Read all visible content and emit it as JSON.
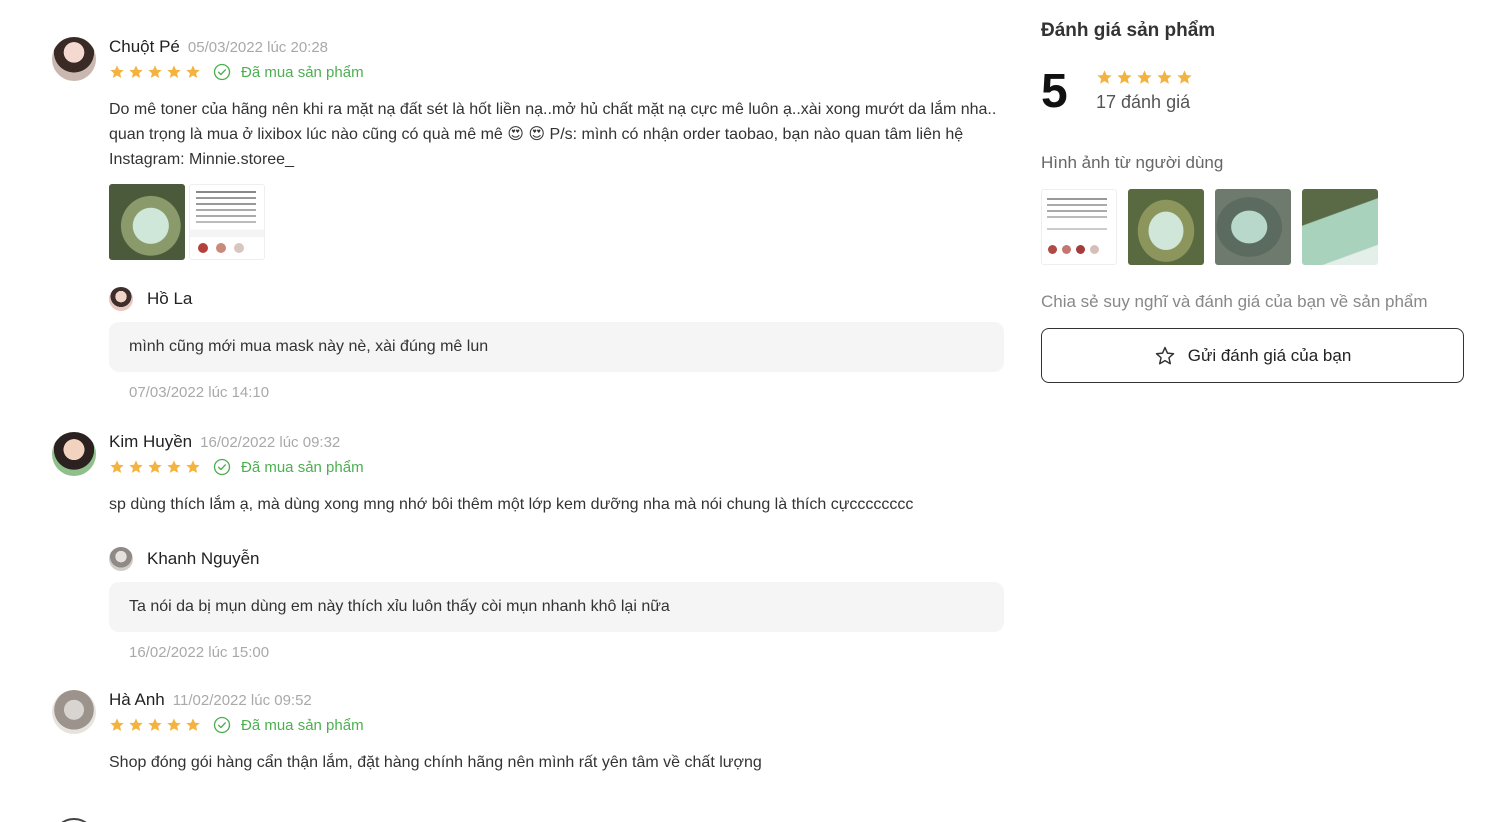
{
  "reviews": [
    {
      "name": "Chuột Pé",
      "time": "05/03/2022 lúc 20:28",
      "rating": 5,
      "verified_label": "Đã mua sản phẩm",
      "content": "Do mê toner của hãng nên khi ra mặt nạ đất sét là hốt liền nạ..mở hủ chất mặt nạ cực mê luôn ạ..xài xong mướt da lắm nha.. quan trọng là mua ở lixibox lúc nào cũng có quà mê mê 😍 😍  P/s: mình có nhận order taobao, bạn nào quan tâm liên hệ Instagram: Minnie.storee_",
      "reply": {
        "name": "Hồ La",
        "text": "mình cũng mới mua mask này nè, xài đúng mê lun",
        "time": "07/03/2022 lúc 14:10"
      }
    },
    {
      "name": "Kim Huyền",
      "time": "16/02/2022 lúc 09:32",
      "rating": 5,
      "verified_label": "Đã mua sản phẩm",
      "content": "sp dùng thích lắm ạ, mà dùng xong mng nhớ bôi thêm một lớp kem dưỡng nha mà nói chung là thích cựcccccccc",
      "reply": {
        "name": "Khanh Nguyễn",
        "text": "Ta nói da bị mụn dùng em này thích xỉu luôn thấy còi mụn nhanh khô lại nữa",
        "time": "16/02/2022 lúc 15:00"
      }
    },
    {
      "name": "Hà Anh",
      "time": "11/02/2022 lúc 09:52",
      "rating": 5,
      "verified_label": "Đã mua sản phẩm",
      "content": "Shop đóng gói hàng cẩn thận lắm, đặt hàng chính hãng nên mình rất yên tâm về chất lượng"
    }
  ],
  "summary": {
    "title": "Đánh giá sản phẩm",
    "score": "5",
    "stars": 5,
    "count": "17 đánh giá",
    "user_images_title": "Hình ảnh từ người dùng",
    "cta_text": "Chia sẻ suy nghĩ và đánh giá của bạn về sản phẩm",
    "cta_button": "Gửi đánh giá của bạn"
  },
  "colors": {
    "star": "#f4b23e",
    "verified": "#4caf50",
    "meta": "#a9a9a9",
    "reply_bg": "#f5f5f5"
  },
  "icons": [
    "star-icon",
    "verified-check-icon",
    "star-outline-icon"
  ]
}
